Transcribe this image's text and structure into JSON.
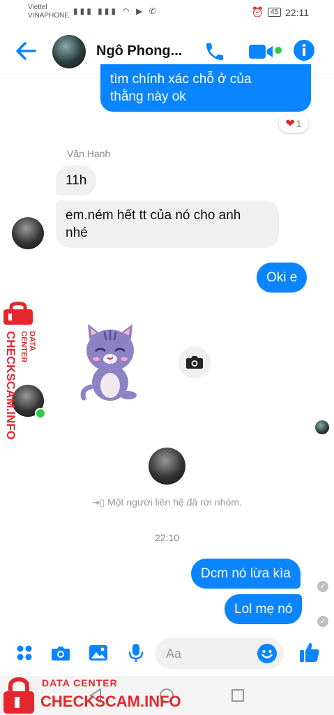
{
  "status_bar": {
    "carrier1": "Viettel",
    "carrier2": "VINAPHONE",
    "battery": "45",
    "time": "22:11"
  },
  "header": {
    "contact_name": "Ngô Phong...",
    "icons": [
      "back-arrow-icon",
      "phone-icon",
      "video-icon",
      "info-icon"
    ],
    "accent_color": "#0a84ff"
  },
  "messages": {
    "m1": "tìm chính xác chỗ ở của\nthằng này ok",
    "m1_reaction": "1",
    "sender": "Văn Hạnh",
    "m2": "11h",
    "m3": "em.ném hết tt của nó cho anh\nnhé",
    "m4": "Oki e",
    "system": "Một người liên hệ đã rời nhóm.",
    "time": "22:10",
    "m5": "Dcm nó lừa kìa",
    "m6": "Lol mẹ nó"
  },
  "composer": {
    "placeholder": "Aa",
    "icons": [
      "apps-icon",
      "camera-icon",
      "image-icon",
      "mic-icon",
      "emoji-icon",
      "like-icon"
    ]
  },
  "watermark": {
    "top": "DATA CENTER",
    "brand": "CHECKSCAM.INFO"
  }
}
